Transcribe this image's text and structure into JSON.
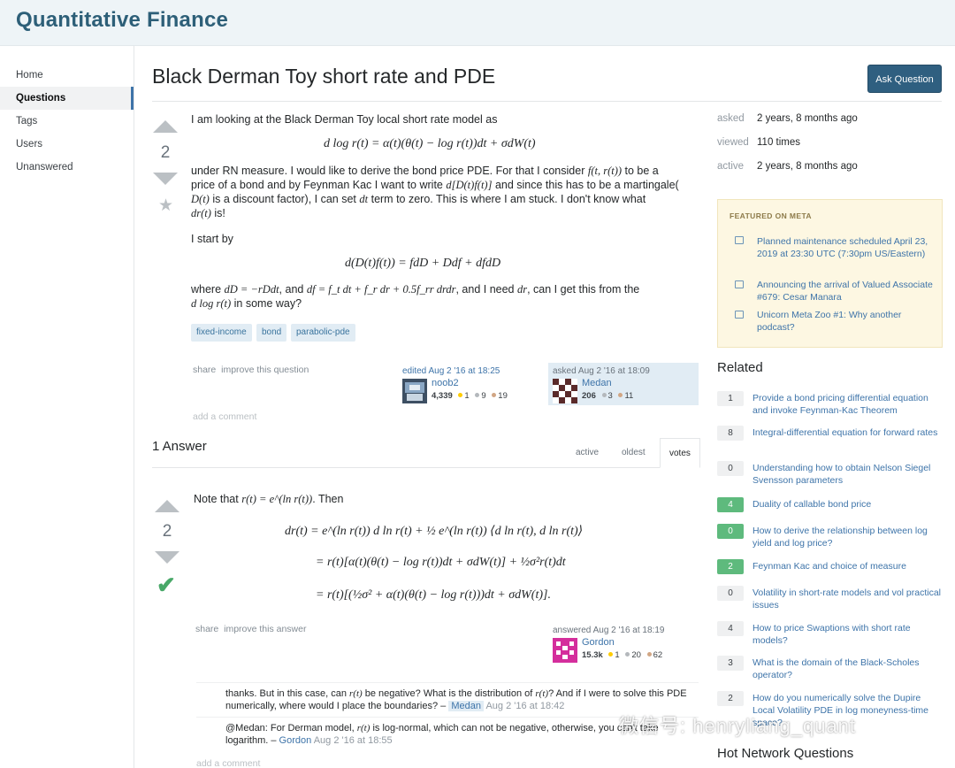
{
  "site": {
    "title": "Quantitative Finance"
  },
  "nav": {
    "items": [
      {
        "label": "Home"
      },
      {
        "label": "Questions"
      },
      {
        "label": "Tags"
      },
      {
        "label": "Users"
      },
      {
        "label": "Unanswered"
      }
    ],
    "active": "Questions"
  },
  "question": {
    "title": "Black Derman Toy short rate and PDE",
    "ask_button": "Ask Question",
    "votes": "2",
    "lines": {
      "l1": "I am looking at the Black Derman Toy local short rate model as",
      "eq1": "d log r(t) = α(t)(θ(t) − log r(t))dt + σdW(t)",
      "l2a": "under RN measure. I would like to derive the bond price PDE. For that I consider",
      "l2b": "f(t, r(t))",
      "l2c": "to be a",
      "l3a": "price of a bond and by Feynman Kac I want to write",
      "l3b": "d[D(t)f(t)]",
      "l3c": "and since this has to be a martingale(",
      "l4a": "D(t)",
      "l4b": "is a discount factor), I can set",
      "l4c": "dt",
      "l4d": "term to zero. This is where I am stuck. I don't know what",
      "l5a": "dr(t)",
      "l5b": "is!",
      "l6": "I start by",
      "eq2": "d(D(t)f(t)) = fdD + Ddf + dfdD",
      "l7a": "where",
      "l7b": "dD = −rDdt",
      "l7c": ", and",
      "l7d": "df = f_t dt + f_r dr + 0.5f_rr drdr",
      "l7e": ", and I need",
      "l7f": "dr",
      "l7g": ", can I get this from the",
      "l8a": "d log r(t)",
      "l8b": "in some way?"
    },
    "tags": [
      "fixed-income",
      "bond",
      "parabolic-pde"
    ],
    "menu": {
      "share": "share",
      "improve": "improve this question"
    },
    "edited": {
      "action": "edited Aug 2 '16 at 18:25",
      "user": "noob2",
      "rep": "4,339",
      "gold": "1",
      "silver": "9",
      "bronze": "19"
    },
    "asked": {
      "action": "asked Aug 2 '16 at 18:09",
      "user": "Medan",
      "rep": "206",
      "silver": "3",
      "bronze": "11"
    },
    "add_comment": "add a comment"
  },
  "answers": {
    "count_label": "1 Answer",
    "tabs": [
      "active",
      "oldest",
      "votes"
    ],
    "active_tab": "votes"
  },
  "answer": {
    "votes": "2",
    "intro_a": "Note that",
    "intro_b": "r(t) = e^(ln r(t))",
    "intro_c": ". Then",
    "eq1": "dr(t) = e^(ln r(t)) d ln r(t) + ½ e^(ln r(t)) ⟨d ln r(t), d ln r(t)⟩",
    "eq2": "= r(t)[α(t)(θ(t) − log r(t))dt + σdW(t)] + ½σ²r(t)dt",
    "eq3": "= r(t)[(½σ² + α(t)(θ(t) − log r(t)))dt + σdW(t)].",
    "menu": {
      "share": "share",
      "improve": "improve this answer"
    },
    "answered": {
      "action": "answered Aug 2 '16 at 18:19",
      "user": "Gordon",
      "rep": "15.3k",
      "gold": "1",
      "silver": "20",
      "bronze": "62"
    },
    "comments": [
      {
        "text_a": "thanks. But in this case, can",
        "m1": "r(t)",
        "text_b": "be negative? What is the distribution of",
        "m2": "r(t)",
        "text_c": "? And if I were to solve this PDE numerically, where would I place the boundaries? –",
        "user": "Medan",
        "date": "Aug 2 '16 at 18:42"
      },
      {
        "text_a": "@Medan: For Derman model,",
        "m1": "r(t)",
        "text_b": "is log-normal, which can not be negative, otherwise, you can't take logarithm. –",
        "user": "Gordon",
        "date": "Aug 2 '16 at 18:55"
      }
    ],
    "add_comment": "add a comment"
  },
  "sidebar": {
    "meta": [
      {
        "label": "asked",
        "value": "2 years, 8 months ago"
      },
      {
        "label": "viewed",
        "value": "110 times"
      },
      {
        "label": "active",
        "value": "2 years, 8 months ago"
      }
    ],
    "featured": {
      "heading": "FEATURED ON META",
      "items": [
        "Planned maintenance scheduled April 23, 2019 at 23:30 UTC (7:30pm US/Eastern)",
        "Announcing the arrival of Valued Associate #679: Cesar Manara",
        "Unicorn Meta Zoo #1: Why another podcast?"
      ]
    },
    "related_heading": "Related",
    "related": [
      {
        "count": "1",
        "answered": false,
        "title": "Provide a bond pricing differential equation and invoke Feynman-Kac Theorem"
      },
      {
        "count": "8",
        "answered": false,
        "title": "Integral-differential equation for forward rates"
      },
      {
        "count": "0",
        "answered": false,
        "title": "Understanding how to obtain Nelson Siegel Svensson parameters"
      },
      {
        "count": "4",
        "answered": true,
        "title": "Duality of callable bond price"
      },
      {
        "count": "0",
        "answered": true,
        "title": "How to derive the relationship between log yield and log price?"
      },
      {
        "count": "2",
        "answered": true,
        "title": "Feynman Kac and choice of measure"
      },
      {
        "count": "0",
        "answered": false,
        "title": "Volatility in short-rate models and vol practical issues"
      },
      {
        "count": "4",
        "answered": false,
        "title": "How to price Swaptions with short rate models?"
      },
      {
        "count": "3",
        "answered": false,
        "title": "What is the domain of the Black-Scholes operator?"
      },
      {
        "count": "2",
        "answered": false,
        "title": "How do you numerically solve the Dupire Local Volatility PDE in log moneyness-time space?"
      }
    ],
    "hot_heading": "Hot Network Questions"
  },
  "watermark": "微信号: henryliang_quant",
  "colors": {
    "brand": "#2d5f78",
    "link": "#3e74a9",
    "accept": "#48a868",
    "button": "#2f5f80",
    "answered_count": "#5eba7d"
  }
}
